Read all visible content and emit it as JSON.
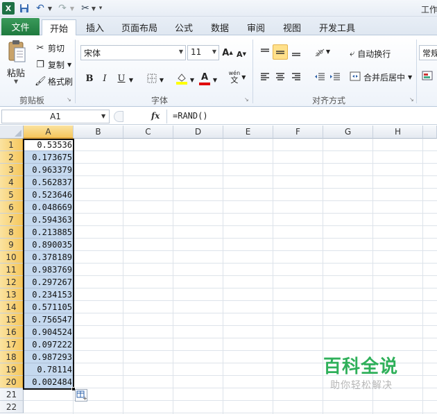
{
  "title_bar": {
    "app_icon": "X",
    "window_title": "工作"
  },
  "tabs": {
    "file": "文件",
    "home": "开始",
    "insert": "插入",
    "page_layout": "页面布局",
    "formulas": "公式",
    "data": "数据",
    "review": "审阅",
    "view": "视图",
    "developer": "开发工具"
  },
  "ribbon": {
    "clipboard": {
      "paste": "粘贴",
      "cut": "剪切",
      "copy": "复制",
      "format_painter": "格式刷",
      "group_label": "剪贴板"
    },
    "font": {
      "font_name": "宋体",
      "font_size": "11",
      "grow_label": "A",
      "shrink_label": "A",
      "bold_label": "B",
      "italic_label": "I",
      "underline_label": "U",
      "font_color_label": "A",
      "phonetic_top": "wén",
      "phonetic_bottom": "文",
      "group_label": "字体"
    },
    "alignment": {
      "wrap_text": "自动换行",
      "merge_center": "合并后居中",
      "group_label": "对齐方式"
    },
    "number": {
      "format": "常规"
    }
  },
  "formula_bar": {
    "name_box": "A1",
    "fx": "fx",
    "formula": "=RAND()"
  },
  "sheet": {
    "columns": [
      "A",
      "B",
      "C",
      "D",
      "E",
      "F",
      "G",
      "H"
    ],
    "rows": [
      "1",
      "2",
      "3",
      "4",
      "5",
      "6",
      "7",
      "8",
      "9",
      "10",
      "11",
      "12",
      "13",
      "14",
      "15",
      "16",
      "17",
      "18",
      "19",
      "20",
      "21",
      "22"
    ],
    "column_a_values": [
      "0.53536",
      "0.173675",
      "0.963379",
      "0.562837",
      "0.523646",
      "0.048669",
      "0.594363",
      "0.213885",
      "0.890035",
      "0.378189",
      "0.983769",
      "0.297267",
      "0.234153",
      "0.571105",
      "0.756547",
      "0.904524",
      "0.097222",
      "0.987293",
      "0.78114",
      "0.002484"
    ],
    "selection_fill": "#c5d9ef",
    "header_highlight": "#f5c75e"
  },
  "watermark": {
    "title": "百科全说",
    "subtitle": "助你轻松解决"
  }
}
